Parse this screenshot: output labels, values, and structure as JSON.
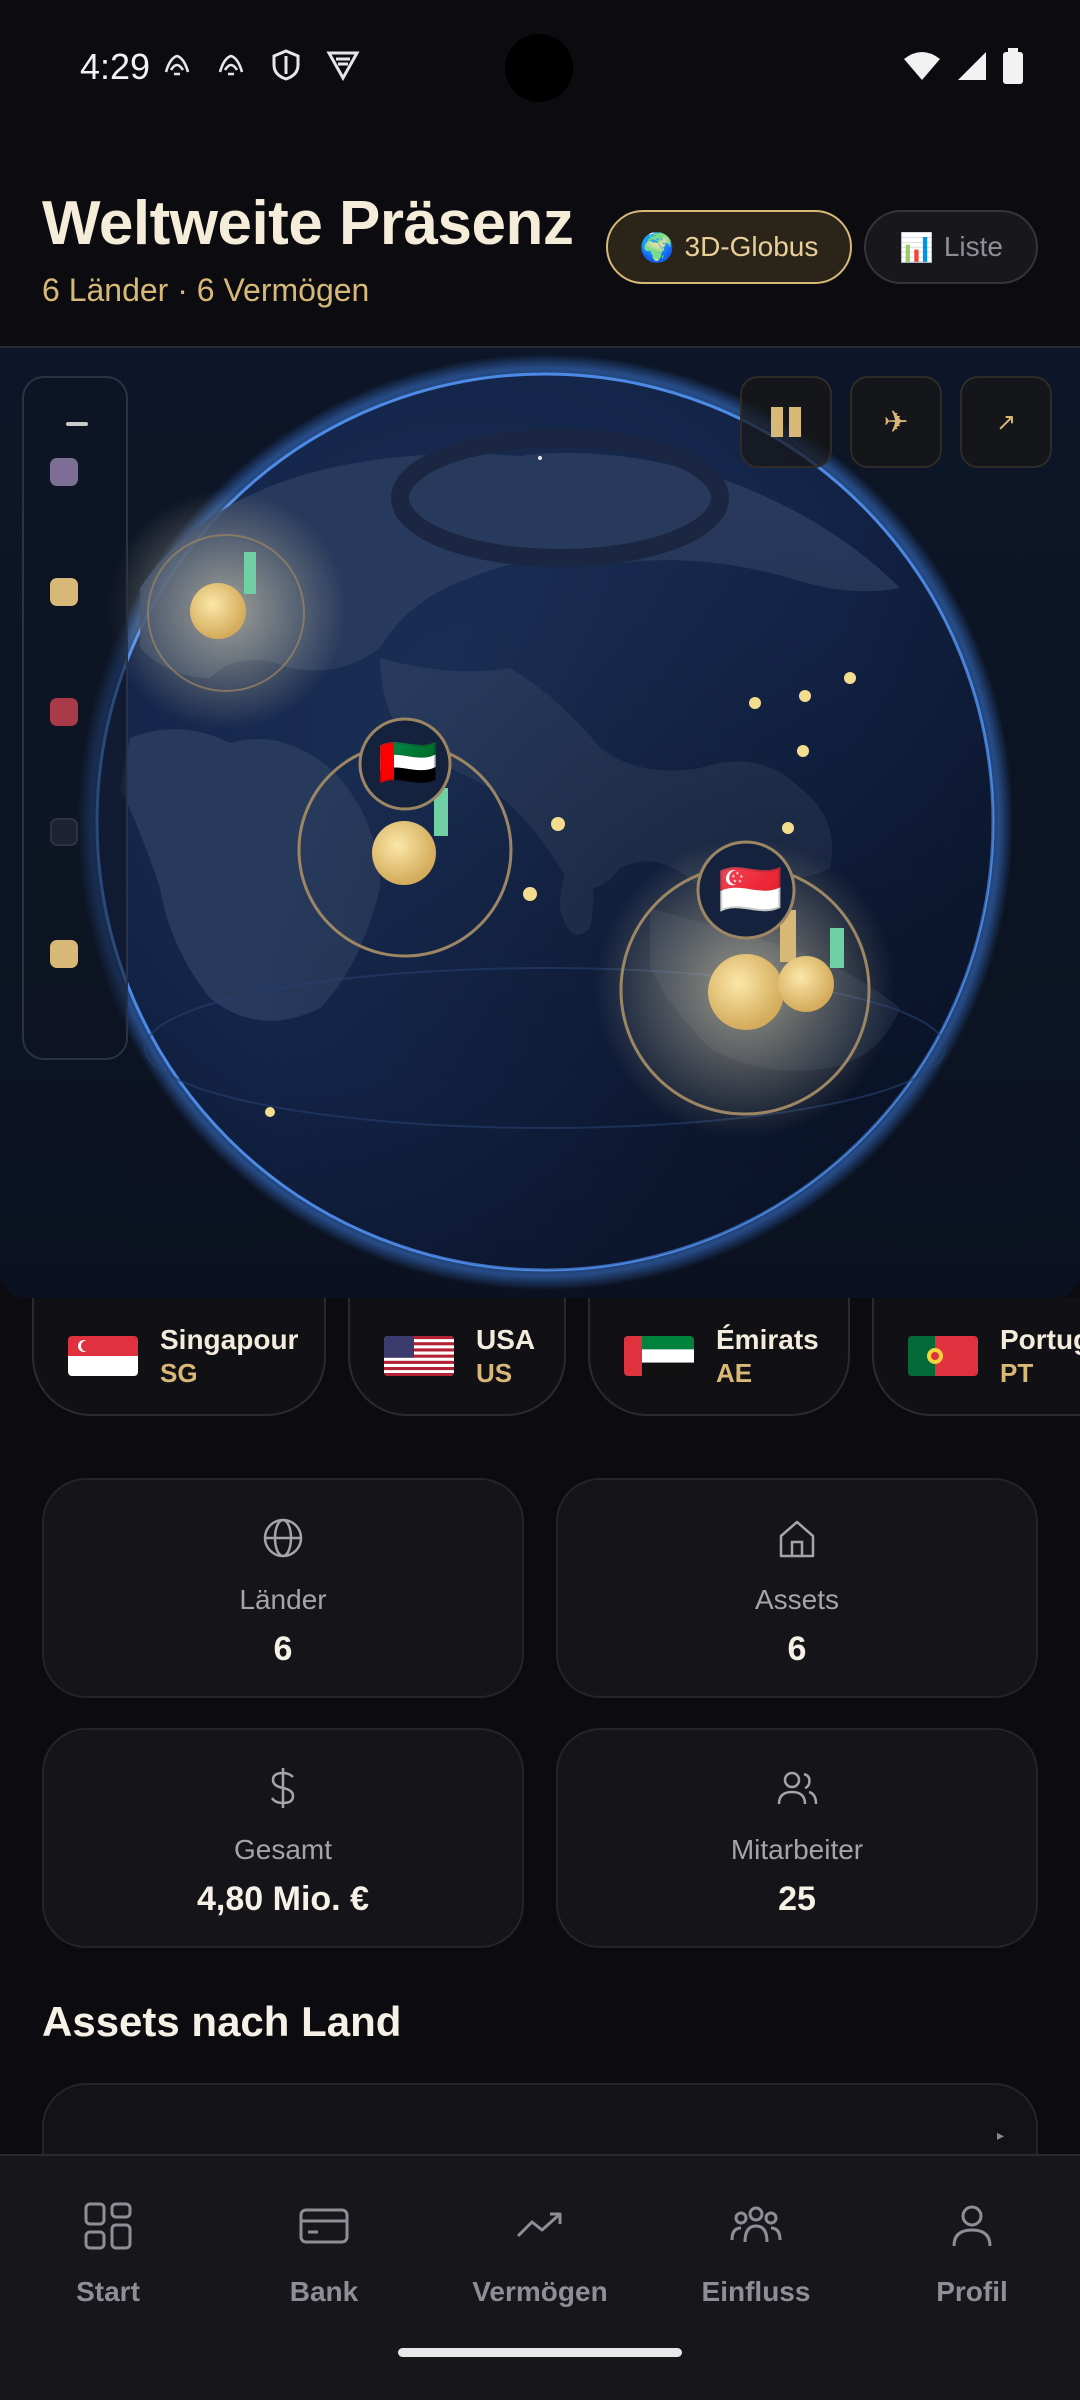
{
  "status_bar": {
    "time": "4:29",
    "left_icons": [
      "notification-icon",
      "notification-icon",
      "shield-icon",
      "vpn-icon"
    ],
    "right_icons": [
      "wifi-icon",
      "signal-icon",
      "battery-icon"
    ]
  },
  "header": {
    "title": "Weltweite Präsenz",
    "subtitle": "6 Länder · 6 Vermögen",
    "view_toggle": [
      {
        "icon": "🌍",
        "label": "3D-Globus",
        "active": true
      },
      {
        "icon": "📊",
        "label": "Liste",
        "active": false
      }
    ]
  },
  "globe": {
    "controls": [
      {
        "icon": "pause-icon"
      },
      {
        "icon": "airplane-icon",
        "glyph": "✈"
      },
      {
        "icon": "expand-icon",
        "glyph": "↗"
      }
    ],
    "legend_colors": [
      "#7d6e96",
      "#d8b877",
      "#a83a4a",
      "#1e2230",
      "#d8b877"
    ],
    "markers": [
      {
        "flag": "🇦🇪",
        "country": "AE"
      },
      {
        "flag": "🇸🇬",
        "country": "SG"
      }
    ]
  },
  "countries": [
    {
      "flag": "🇸🇬",
      "name": "Singapour",
      "code": "SG"
    },
    {
      "flag": "🇺🇸",
      "name": "USA",
      "code": "US"
    },
    {
      "flag": "🇦🇪",
      "name": "Émirats",
      "code": "AE"
    },
    {
      "flag": "🇵🇹",
      "name": "Portugal",
      "code": "PT"
    }
  ],
  "stats": [
    {
      "icon": "globe-icon",
      "label": "Länder",
      "value": "6"
    },
    {
      "icon": "home-icon",
      "label": "Assets",
      "value": "6"
    },
    {
      "icon": "dollar-icon",
      "label": "Gesamt",
      "value": "4,80 Mio. €"
    },
    {
      "icon": "users-icon",
      "label": "Mitarbeiter",
      "value": "25"
    }
  ],
  "assets_section": {
    "title": "Assets nach Land"
  },
  "bottom_nav": [
    {
      "icon": "grid-icon",
      "label": "Start"
    },
    {
      "icon": "card-icon",
      "label": "Bank"
    },
    {
      "icon": "trend-icon",
      "label": "Vermögen"
    },
    {
      "icon": "people-icon",
      "label": "Einfluss"
    },
    {
      "icon": "person-icon",
      "label": "Profil"
    }
  ]
}
